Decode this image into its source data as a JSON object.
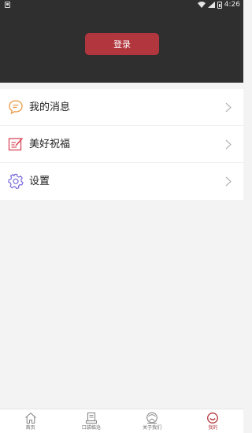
{
  "status_bar": {
    "time": "4:26"
  },
  "header": {
    "login_label": "登录"
  },
  "menu": {
    "items": [
      {
        "label": "我的消息",
        "icon": "message-icon",
        "color": "#e89a4a"
      },
      {
        "label": "美好祝福",
        "icon": "blessing-icon",
        "color": "#d9485a"
      },
      {
        "label": "设置",
        "icon": "settings-icon",
        "color": "#7a6ad8"
      }
    ]
  },
  "bottom_nav": {
    "items": [
      {
        "label": "首页",
        "icon": "home-icon",
        "active": false
      },
      {
        "label": "口袋临沧",
        "icon": "pocket-icon",
        "active": false
      },
      {
        "label": "关于我们",
        "icon": "about-icon",
        "active": false
      },
      {
        "label": "我的",
        "icon": "profile-icon",
        "active": true
      }
    ]
  },
  "colors": {
    "accent": "#b2363d",
    "header_bg": "#2f2f2f"
  }
}
